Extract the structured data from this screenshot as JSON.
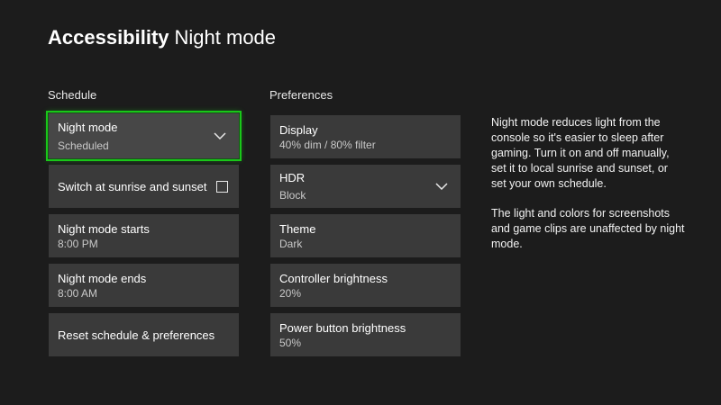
{
  "page": {
    "section": "Accessibility",
    "title": "Night mode"
  },
  "schedule": {
    "heading": "Schedule",
    "night_mode": {
      "label": "Night mode",
      "value": "Scheduled",
      "icon": "chevron-down-icon"
    },
    "sunrise_sunset": {
      "label": "Switch at sunrise and sunset",
      "checked": false,
      "icon": "checkbox-icon"
    },
    "starts": {
      "label": "Night mode starts",
      "value": "8:00 PM"
    },
    "ends": {
      "label": "Night mode ends",
      "value": "8:00 AM"
    },
    "reset": {
      "label": "Reset schedule & preferences"
    }
  },
  "preferences": {
    "heading": "Preferences",
    "display": {
      "label": "Display",
      "value": "40% dim / 80% filter"
    },
    "hdr": {
      "label": "HDR",
      "value": "Block",
      "icon": "chevron-down-icon"
    },
    "theme": {
      "label": "Theme",
      "value": "Dark"
    },
    "controller_brightness": {
      "label": "Controller brightness",
      "value": "20%"
    },
    "power_button_brightness": {
      "label": "Power button brightness",
      "value": "50%"
    }
  },
  "description": {
    "paragraph1": "Night mode reduces light from the console so it's easier to sleep after gaming. Turn it on and off manually, set it to local sunrise and sunset, or set your own schedule.",
    "paragraph2": "The light and colors for screenshots and game clips are unaffected by night mode."
  },
  "colors": {
    "background": "#1c1c1c",
    "tile": "#3a3a3a",
    "focus_accent": "#19c719"
  }
}
